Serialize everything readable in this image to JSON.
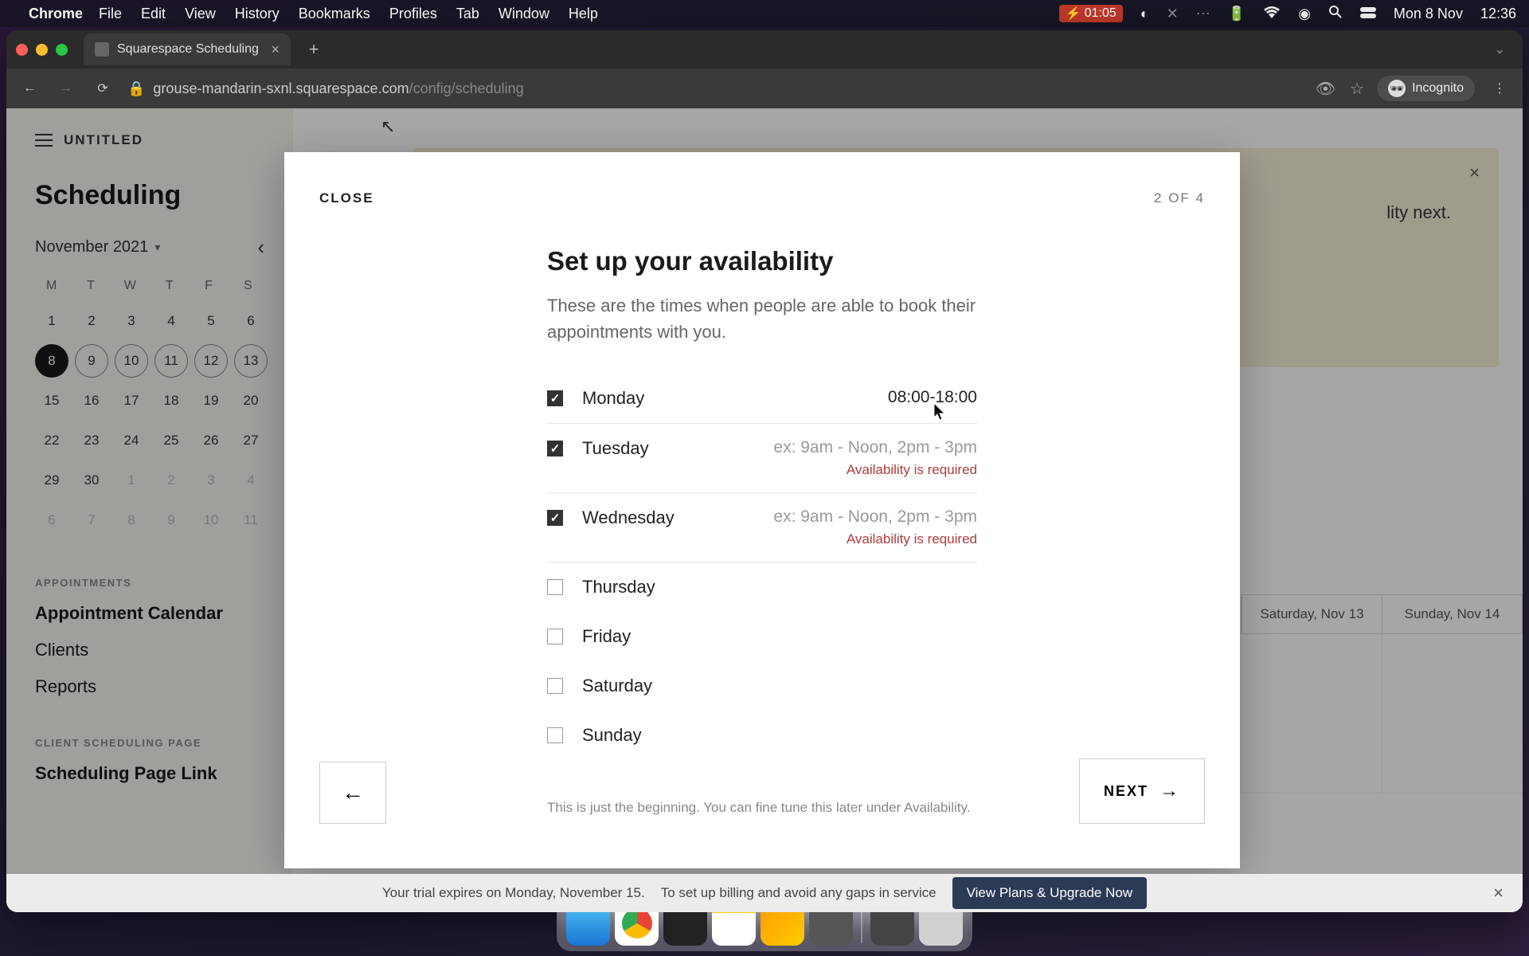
{
  "menubar": {
    "app": "Chrome",
    "items": [
      "File",
      "Edit",
      "View",
      "History",
      "Bookmarks",
      "Profiles",
      "Tab",
      "Window",
      "Help"
    ],
    "battery_time": "01:05",
    "date": "Mon 8 Nov",
    "time": "12:36"
  },
  "tab": {
    "title": "Squarespace Scheduling"
  },
  "url": {
    "host": "grouse-mandarin-sxnl.squarespace.com",
    "path": "/config/scheduling"
  },
  "incognito_label": "Incognito",
  "sidebar": {
    "site_name": "UNTITLED",
    "title": "Scheduling",
    "month": "November 2021",
    "day_headers": [
      "M",
      "T",
      "W",
      "T",
      "F",
      "S"
    ],
    "weeks": [
      [
        {
          "n": "1"
        },
        {
          "n": "2"
        },
        {
          "n": "3"
        },
        {
          "n": "4"
        },
        {
          "n": "5"
        },
        {
          "n": "6"
        }
      ],
      [
        {
          "n": "8",
          "today": true
        },
        {
          "n": "9",
          "c": true
        },
        {
          "n": "10",
          "c": true
        },
        {
          "n": "11",
          "c": true
        },
        {
          "n": "12",
          "c": true
        },
        {
          "n": "13",
          "c": true
        }
      ],
      [
        {
          "n": "15"
        },
        {
          "n": "16"
        },
        {
          "n": "17"
        },
        {
          "n": "18"
        },
        {
          "n": "19"
        },
        {
          "n": "20"
        }
      ],
      [
        {
          "n": "22"
        },
        {
          "n": "23"
        },
        {
          "n": "24"
        },
        {
          "n": "25"
        },
        {
          "n": "26"
        },
        {
          "n": "27"
        }
      ],
      [
        {
          "n": "29"
        },
        {
          "n": "30"
        },
        {
          "n": "1",
          "o": true
        },
        {
          "n": "2",
          "o": true
        },
        {
          "n": "3",
          "o": true
        },
        {
          "n": "4",
          "o": true
        }
      ],
      [
        {
          "n": "6",
          "o": true
        },
        {
          "n": "7",
          "o": true
        },
        {
          "n": "8",
          "o": true
        },
        {
          "n": "9",
          "o": true
        },
        {
          "n": "10",
          "o": true
        },
        {
          "n": "11",
          "o": true
        }
      ]
    ],
    "appointments_label": "APPOINTMENTS",
    "links_appointments": [
      "Appointment Calendar",
      "Clients",
      "Reports"
    ],
    "client_page_label": "CLIENT SCHEDULING PAGE",
    "links_client": [
      "Scheduling Page Link"
    ]
  },
  "bg": {
    "banner_hint": "lity next.",
    "week_headers": [
      "Saturday, Nov 13",
      "Sunday, Nov 14"
    ]
  },
  "modal": {
    "close": "CLOSE",
    "step": "2 OF 4",
    "title": "Set up your availability",
    "subtitle": "These are the times when people are able to book their appointments with you.",
    "days": [
      {
        "name": "Monday",
        "checked": true,
        "value": "08:00-18:00"
      },
      {
        "name": "Tuesday",
        "checked": true,
        "placeholder": "ex: 9am - Noon, 2pm - 3pm",
        "error": "Availability is required"
      },
      {
        "name": "Wednesday",
        "checked": true,
        "placeholder": "ex: 9am - Noon, 2pm - 3pm",
        "error": "Availability is required"
      },
      {
        "name": "Thursday",
        "checked": false
      },
      {
        "name": "Friday",
        "checked": false
      },
      {
        "name": "Saturday",
        "checked": false
      },
      {
        "name": "Sunday",
        "checked": false
      }
    ],
    "footnote": "This is just the beginning. You can fine tune this later under Availability.",
    "next": "NEXT"
  },
  "trial": {
    "text1": "Your trial expires on Monday, November 15.",
    "text2": "To set up billing and avoid any gaps in service",
    "button": "View Plans & Upgrade Now"
  }
}
